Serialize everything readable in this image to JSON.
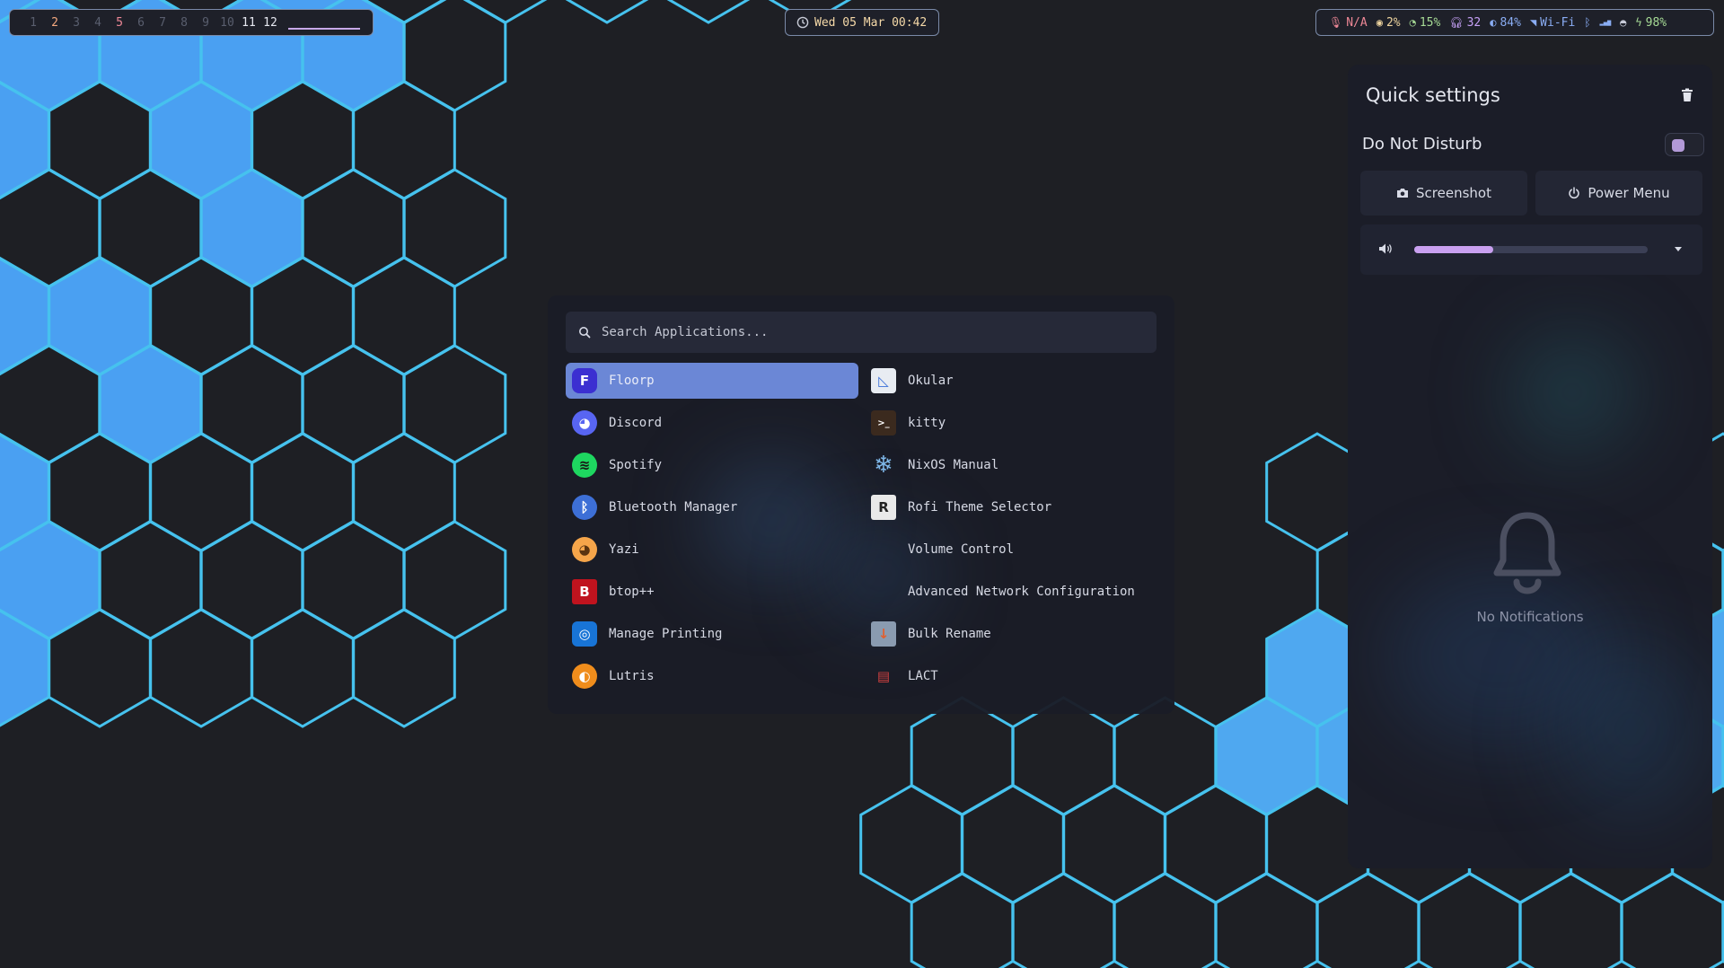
{
  "topbar": {
    "workspaces": [
      {
        "label": "1",
        "state": "empty"
      },
      {
        "label": "2",
        "state": "active"
      },
      {
        "label": "3",
        "state": "empty"
      },
      {
        "label": "4",
        "state": "empty"
      },
      {
        "label": "5",
        "state": "urgent"
      },
      {
        "label": "6",
        "state": "empty"
      },
      {
        "label": "7",
        "state": "empty"
      },
      {
        "label": "8",
        "state": "empty"
      },
      {
        "label": "9",
        "state": "empty"
      },
      {
        "label": "10",
        "state": "empty"
      },
      {
        "label": "11",
        "state": "occupied"
      },
      {
        "label": "12",
        "state": "occupied"
      }
    ],
    "clock": "Wed 05 Mar 00:42",
    "status": [
      {
        "icon": "microphone-icon",
        "text": "N/A",
        "color": "#ed8796"
      },
      {
        "icon": "cpu-icon",
        "text": "2%",
        "color": "#eed49f"
      },
      {
        "icon": "memory-icon",
        "text": "15%",
        "color": "#a6da95"
      },
      {
        "icon": "headphones-icon",
        "text": "32",
        "color": "#c6a0f6"
      },
      {
        "icon": "brightness-icon",
        "text": "84%",
        "color": "#8aadf4"
      },
      {
        "icon": "wifi-icon",
        "text": "Wi-Fi",
        "color": "#8aadf4"
      },
      {
        "icon": "bluetooth-icon",
        "text": "",
        "color": "#8aadf4"
      },
      {
        "icon": "signal-icon",
        "text": "",
        "color": "#8aadf4"
      },
      {
        "icon": "discord-icon",
        "text": "",
        "color": "#c8cbd8"
      },
      {
        "icon": "battery-charging-icon",
        "text": "98%",
        "color": "#a6da95"
      }
    ]
  },
  "launcher": {
    "search_placeholder": "Search Applications...",
    "apps_left": [
      {
        "label": "Floorp",
        "icon": "floorp-icon",
        "selected": true
      },
      {
        "label": "Discord",
        "icon": "discord-icon"
      },
      {
        "label": "Spotify",
        "icon": "spotify-icon"
      },
      {
        "label": "Bluetooth Manager",
        "icon": "bluetooth-icon"
      },
      {
        "label": "Yazi",
        "icon": "yazi-icon"
      },
      {
        "label": "btop++",
        "icon": "btop-icon"
      },
      {
        "label": "Manage Printing",
        "icon": "printer-icon"
      },
      {
        "label": "Lutris",
        "icon": "lutris-icon"
      }
    ],
    "apps_right": [
      {
        "label": "Okular",
        "icon": "okular-icon"
      },
      {
        "label": "kitty",
        "icon": "kitty-icon"
      },
      {
        "label": "NixOS Manual",
        "icon": "nixos-icon"
      },
      {
        "label": "Rofi Theme Selector",
        "icon": "rofi-icon"
      },
      {
        "label": "Volume Control",
        "icon": ""
      },
      {
        "label": "Advanced Network Configuration",
        "icon": ""
      },
      {
        "label": "Bulk Rename",
        "icon": "bulk-rename-icon"
      },
      {
        "label": "LACT",
        "icon": "lact-icon"
      }
    ]
  },
  "quick_settings": {
    "title": "Quick settings",
    "dnd_label": "Do Not Disturb",
    "dnd_enabled": false,
    "screenshot_label": "Screenshot",
    "power_label": "Power Menu",
    "volume_level": 0.34,
    "no_notifications": "No Notifications"
  }
}
